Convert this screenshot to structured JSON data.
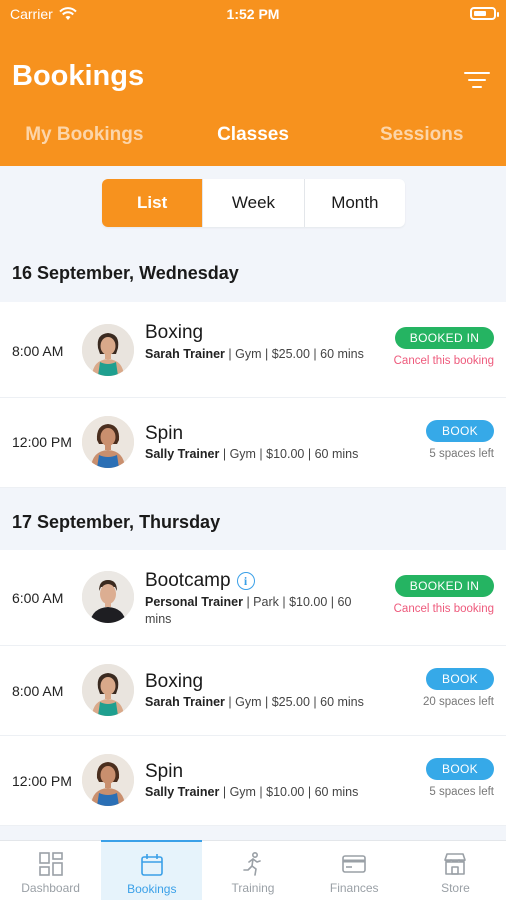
{
  "status": {
    "carrier": "Carrier",
    "time": "1:52 PM"
  },
  "header": {
    "title": "Bookings"
  },
  "tabs": [
    {
      "label": "My Bookings",
      "active": false
    },
    {
      "label": "Classes",
      "active": true
    },
    {
      "label": "Sessions",
      "active": false
    }
  ],
  "view_toggle": [
    {
      "label": "List",
      "active": true
    },
    {
      "label": "Week",
      "active": false
    },
    {
      "label": "Month",
      "active": false
    }
  ],
  "days": [
    {
      "date": "16 September, Wednesday",
      "classes": [
        {
          "time": "8:00 AM",
          "name": "Boxing",
          "trainer": "Sarah Trainer",
          "details": "| Gym | $25.00 | 60 mins",
          "status": "BOOKED IN",
          "note": "Cancel this booking",
          "avatar": "trainer-female-green"
        },
        {
          "time": "12:00 PM",
          "name": "Spin",
          "trainer": "Sally Trainer",
          "details": "| Gym | $10.00 | 60 mins",
          "status": "BOOK",
          "note": "5 spaces left",
          "avatar": "trainer-female-blue"
        }
      ]
    },
    {
      "date": "17 September, Thursday",
      "classes": [
        {
          "time": "6:00 AM",
          "name": "Bootcamp",
          "trainer": "Personal Trainer",
          "details": "| Park | $10.00 | 60 mins",
          "status": "BOOKED IN",
          "note": "Cancel this booking",
          "avatar": "trainer-male"
        },
        {
          "time": "8:00 AM",
          "name": "Boxing",
          "trainer": "Sarah Trainer",
          "details": "| Gym | $25.00 | 60 mins",
          "status": "BOOK",
          "note": "20 spaces left",
          "avatar": "trainer-female-green"
        },
        {
          "time": "12:00 PM",
          "name": "Spin",
          "trainer": "Sally Trainer",
          "details": "| Gym | $10.00 | 60 mins",
          "status": "BOOK",
          "note": "5 spaces left",
          "avatar": "trainer-female-blue"
        }
      ]
    }
  ],
  "bottom_nav": [
    {
      "label": "Dashboard",
      "icon": "dashboard-icon",
      "active": false
    },
    {
      "label": "Bookings",
      "icon": "calendar-icon",
      "active": true
    },
    {
      "label": "Training",
      "icon": "running-icon",
      "active": false
    },
    {
      "label": "Finances",
      "icon": "card-icon",
      "active": false
    },
    {
      "label": "Store",
      "icon": "store-icon",
      "active": false
    }
  ],
  "colors": {
    "brand": "#f7921e",
    "booked": "#25b462",
    "book": "#36a9e8",
    "cancel": "#ee5a7c",
    "nav_active": "#3aa0e8"
  }
}
